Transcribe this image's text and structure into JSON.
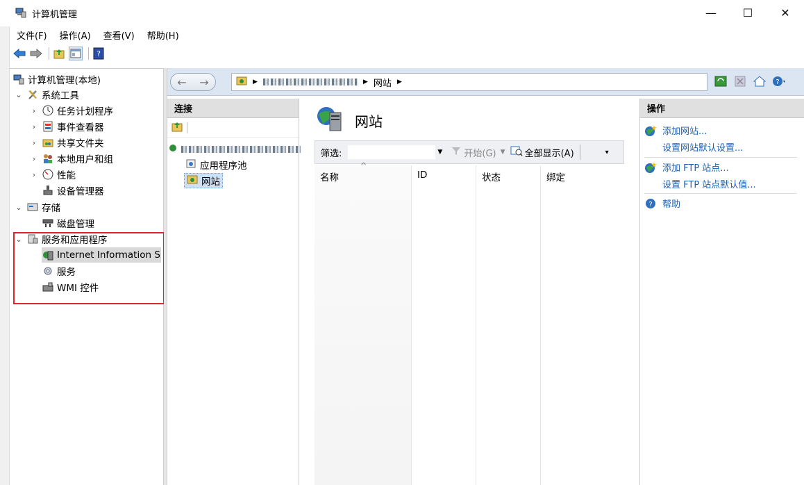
{
  "window": {
    "title": "计算机管理",
    "minimize": "—",
    "maximize": "☐",
    "close": "✕"
  },
  "menu": [
    "文件(F)",
    "操作(A)",
    "查看(V)",
    "帮助(H)"
  ],
  "tree": {
    "root": "计算机管理(本地)",
    "system_tools": "系统工具",
    "task_scheduler": "任务计划程序",
    "event_viewer": "事件查看器",
    "shared_folders": "共享文件夹",
    "local_users": "本地用户和组",
    "performance": "性能",
    "device_manager": "设备管理器",
    "storage": "存储",
    "disk_management": "磁盘管理",
    "services_apps": "服务和应用程序",
    "iis": "Internet Information S",
    "services": "服务",
    "wmi": "WMI 控件"
  },
  "address": {
    "crumb_sites": "网站"
  },
  "connections": {
    "header": "连接",
    "app_pools": "应用程序池",
    "sites": "网站"
  },
  "main": {
    "title": "网站",
    "filter_label": "筛选:",
    "start_label": "开始(G)",
    "show_all_label": "全部显示(A)",
    "columns": [
      "名称",
      "ID",
      "状态",
      "绑定"
    ]
  },
  "actions": {
    "header": "操作",
    "add_site": "添加网站...",
    "site_defaults": "设置网站默认设置...",
    "add_ftp": "添加 FTP 站点...",
    "ftp_defaults": "设置 FTP 站点默认值...",
    "help": "帮助"
  }
}
